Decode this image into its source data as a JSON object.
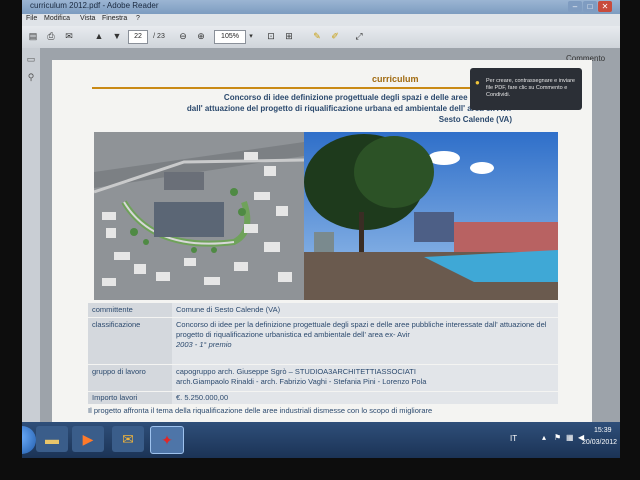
{
  "window": {
    "title": "curriculum 2012.pdf - Adobe Reader",
    "minimize_icon": "minimize-icon",
    "maximize_icon": "maximize-icon",
    "close_icon": "close-icon"
  },
  "menu": [
    "File",
    "Modifica",
    "Vista",
    "Finestra",
    "?"
  ],
  "toolbar": {
    "page_current": "22",
    "page_total": "/ 23",
    "zoom": "105%",
    "comment_label": "Commento"
  },
  "document": {
    "header": "curriculum",
    "title_lines": [
      "Concorso di idee definizione progettuale degli spazi e delle aree interessate",
      "dall' attuazione del progetto di riqualificazione urbana ed ambientale dell' area ex Avir",
      "Sesto Calende (VA)"
    ],
    "table": {
      "committente_label": "committente",
      "committente_value": "Comune di Sesto Calende (VA)",
      "classificazione_label": "classificazione",
      "classificazione_value": "Concorso di idee per la definizione progettuale degli spazi e delle aree pubbliche interessate dall' attuazione del progetto di riqualificazione urbanistica ed ambientale dell' area ex- Avir",
      "classificazione_year": "2003 - 1° premio",
      "gruppo_label": "gruppo di lavoro",
      "gruppo_line1": "capogruppo arch. Giuseppe Sgrò – STUDIOA3ARCHITETTIASSOCIATI",
      "gruppo_line2": "arch.Giampaolo Rinaldi - arch. Fabrizio Vaghi - Stefania Pini - Lorenzo Pola",
      "importo_label": "Importo lavori",
      "importo_value": "€. 5.250.000,00"
    },
    "description": "Il progetto affronta il tema della riqualificazione delle aree industriali dismesse con lo scopo di migliorare"
  },
  "tooltip": {
    "text": "Per creare, contrassegnare e inviare file PDF, fare clic su Commento e Condividi."
  },
  "taskbar": {
    "language": "IT",
    "time": "15:39",
    "date": "20/03/2012"
  }
}
